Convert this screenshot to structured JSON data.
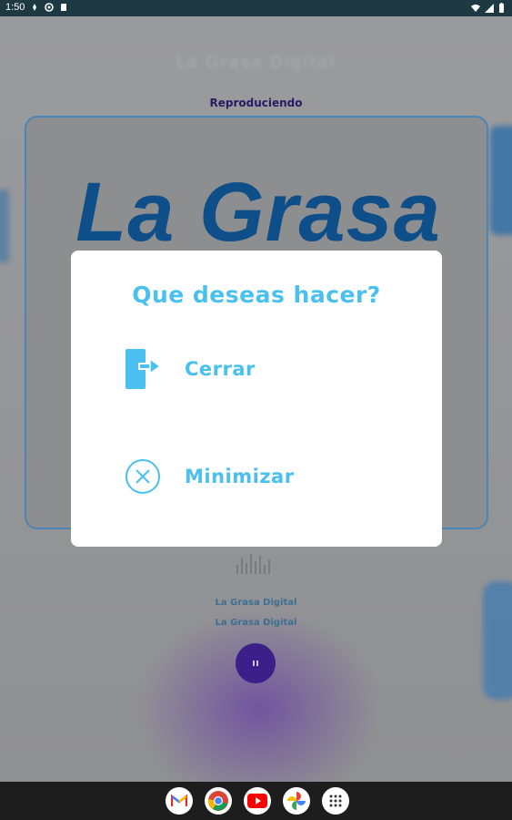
{
  "status_bar": {
    "time": "1:50",
    "icons": [
      "data-saver-icon",
      "vpn-icon",
      "sd-card-icon"
    ],
    "right_icons": [
      "wifi-icon",
      "signal-icon",
      "battery-icon"
    ]
  },
  "app": {
    "header_title": "La Grasa Digital",
    "now_playing_label": "Reproduciendo",
    "artwork_text": "La Grasa",
    "station_name": "La Grasa Digital",
    "station_subtitle": "La Grasa Digital",
    "play_state_icon": "pause-icon"
  },
  "dialog": {
    "title": "Que deseas hacer?",
    "options": [
      {
        "label": "Cerrar",
        "icon": "exit-door-icon"
      },
      {
        "label": "Minimizar",
        "icon": "close-circle-icon"
      }
    ]
  },
  "dock": {
    "apps": [
      "gmail-icon",
      "chrome-icon",
      "youtube-icon",
      "photos-icon",
      "app-drawer-icon"
    ]
  },
  "colors": {
    "accent": "#49c0ee",
    "status_bar_bg": "#1f3942",
    "play_button": "#3c1f88",
    "logo_blue": "#0f4f89"
  }
}
